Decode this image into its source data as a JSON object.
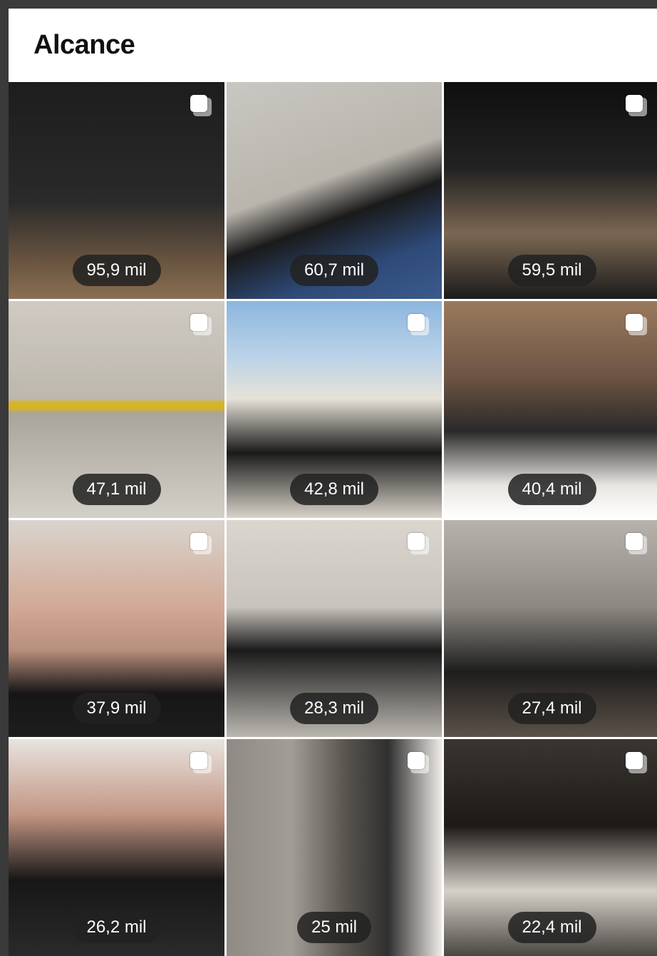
{
  "header": {
    "title": "Alcance"
  },
  "posts": [
    {
      "reach": "95,9 mil"
    },
    {
      "reach": "60,7 mil"
    },
    {
      "reach": "59,5 mil"
    },
    {
      "reach": "47,1 mil"
    },
    {
      "reach": "42,8 mil"
    },
    {
      "reach": "40,4 mil"
    },
    {
      "reach": "37,9 mil"
    },
    {
      "reach": "28,3 mil"
    },
    {
      "reach": "27,4 mil"
    },
    {
      "reach": "26,2 mil"
    },
    {
      "reach": "25 mil"
    },
    {
      "reach": "22,4 mil"
    }
  ],
  "icons": {
    "post_type": "multiple-photos-icon"
  }
}
